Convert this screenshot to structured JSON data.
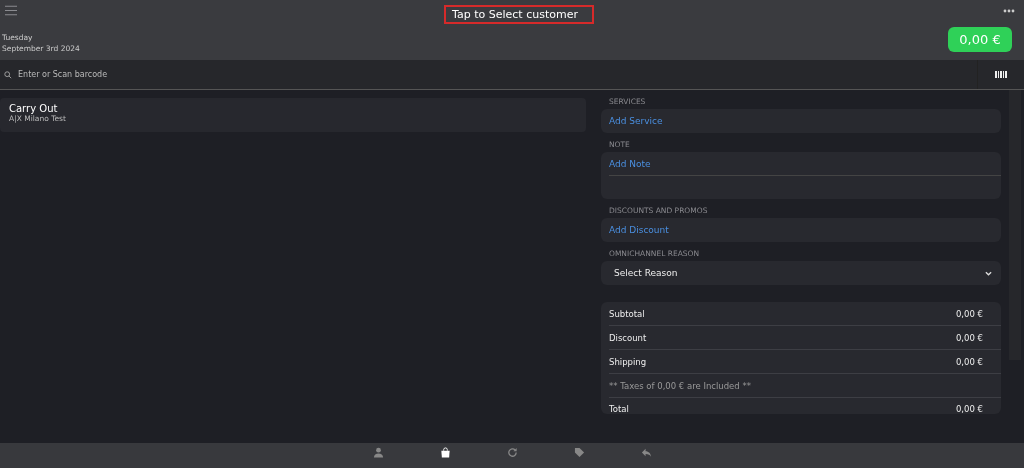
{
  "header": {
    "customer_button": "Tap to Select customer",
    "day": "Tuesday",
    "date": "September 3rd 2024",
    "total_button": "0,00 €"
  },
  "search": {
    "placeholder": "Enter or Scan barcode"
  },
  "order": {
    "title": "Carry Out",
    "store": "A|X Milano Test"
  },
  "sections": [
    {
      "kind": "action",
      "label": "SERVICES",
      "action": "Add Service"
    },
    {
      "kind": "note",
      "label": "NOTE",
      "action": "Add Note"
    },
    {
      "kind": "action",
      "label": "DISCOUNTS AND PROMOS",
      "action": "Add Discount"
    },
    {
      "kind": "select",
      "label": "OMNICHANNEL REASON",
      "action": "Select Reason"
    }
  ],
  "summary": [
    {
      "kind": "amount",
      "label": "Subtotal",
      "value": "0,00 €"
    },
    {
      "kind": "amount",
      "label": "Discount",
      "value": "0,00 €"
    },
    {
      "kind": "amount",
      "label": "Shipping",
      "value": "0,00 €"
    },
    {
      "kind": "note",
      "label": "** Taxes of 0,00 € are Included **"
    },
    {
      "kind": "amount",
      "label": "Total",
      "value": "0,00 €"
    }
  ],
  "tabs": [
    {
      "selected": false
    },
    {
      "selected": true
    },
    {
      "selected": false
    },
    {
      "selected": false
    },
    {
      "selected": false
    }
  ]
}
